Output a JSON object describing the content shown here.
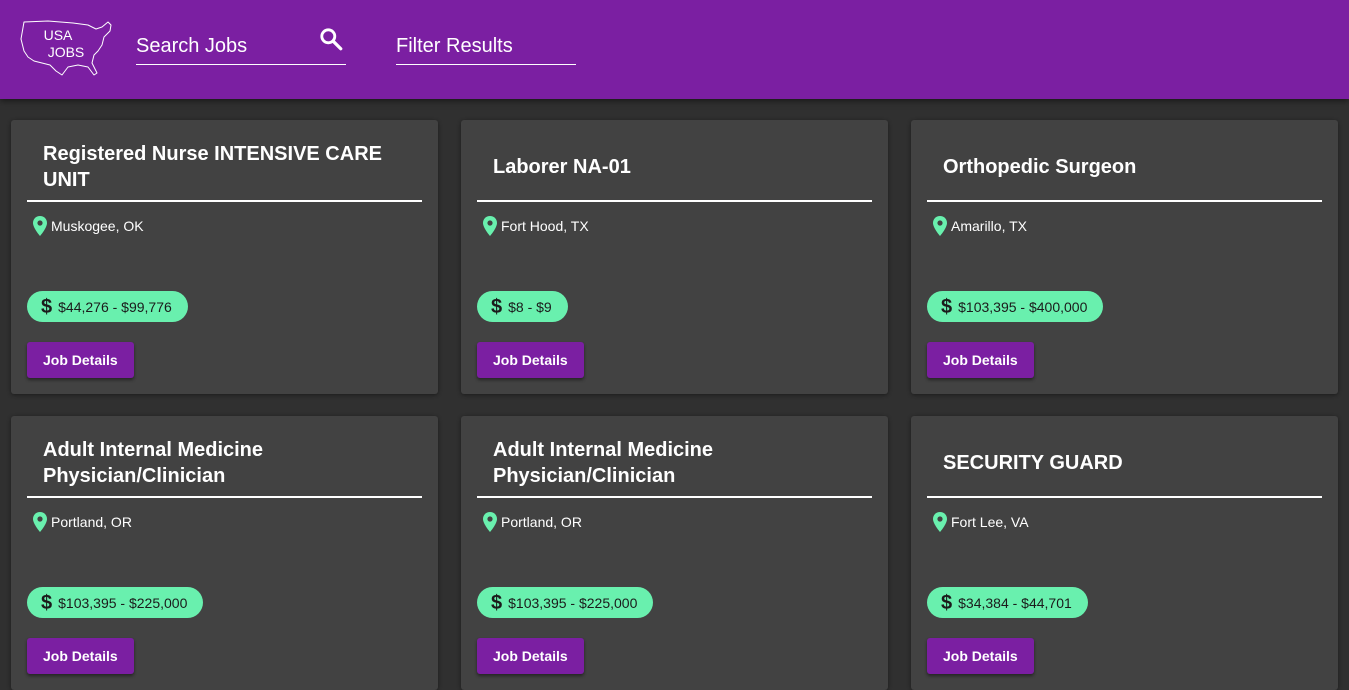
{
  "header": {
    "logo": {
      "line1": "USA",
      "line2": "JOBS"
    },
    "search_placeholder": "Search Jobs",
    "filter_placeholder": "Filter Results",
    "brand_color": "#7b1fa2"
  },
  "accent_color": "#69f0ae",
  "jobs": [
    {
      "title": "Registered Nurse INTENSIVE CARE UNIT",
      "location": "Muskogee, OK",
      "salary": "$44,276 - $99,776",
      "button": "Job Details"
    },
    {
      "title": "Laborer NA-01",
      "location": "Fort Hood, TX",
      "salary": "$8 - $9",
      "button": "Job Details"
    },
    {
      "title": "Orthopedic Surgeon",
      "location": "Amarillo, TX",
      "salary": "$103,395 - $400,000",
      "button": "Job Details"
    },
    {
      "title": "Adult Internal Medicine Physician/Clinician",
      "location": "Portland, OR",
      "salary": "$103,395 - $225,000",
      "button": "Job Details"
    },
    {
      "title": "Adult Internal Medicine Physician/Clinician",
      "location": "Portland, OR",
      "salary": "$103,395 - $225,000",
      "button": "Job Details"
    },
    {
      "title": "SECURITY GUARD",
      "location": "Fort Lee, VA",
      "salary": "$34,384 - $44,701",
      "button": "Job Details"
    }
  ]
}
